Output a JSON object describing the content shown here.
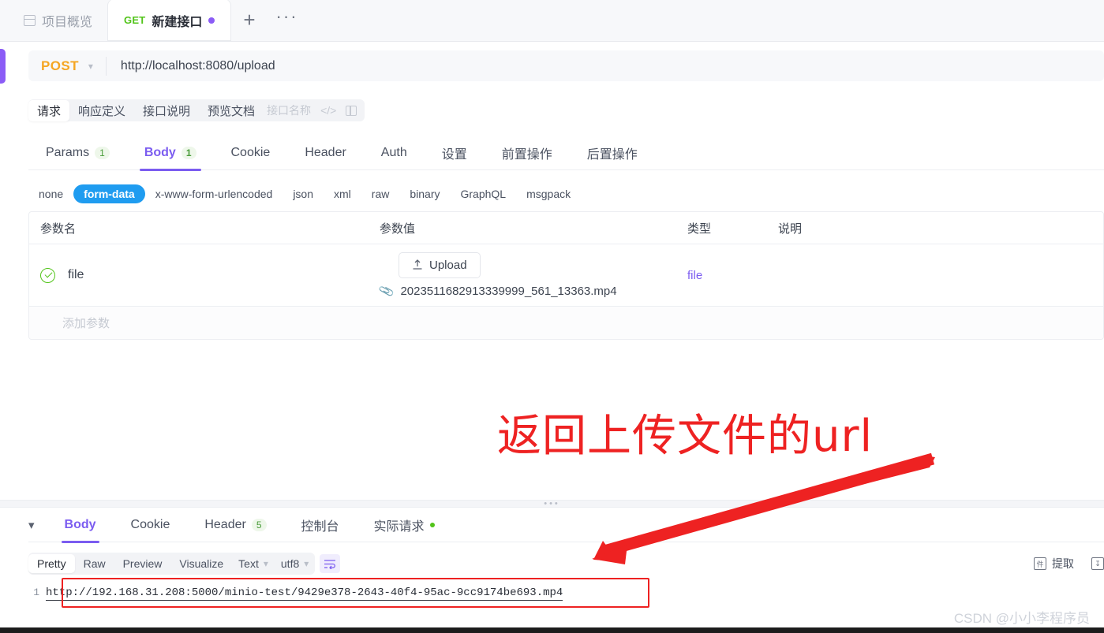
{
  "window": {
    "tabs": [
      {
        "icon": "window-icon",
        "label": "项目概览",
        "active": false
      },
      {
        "method": "GET",
        "label": "新建接口",
        "active": true,
        "dirty_dot": true
      }
    ],
    "new_tab_label": "+",
    "more_label": "···"
  },
  "request": {
    "method": "POST",
    "url": "http://localhost:8080/upload",
    "subtabs": [
      {
        "label": "请求",
        "active": true
      },
      {
        "label": "响应定义",
        "active": false
      },
      {
        "label": "接口说明",
        "active": false
      },
      {
        "label": "预览文档",
        "active": false
      }
    ],
    "name_placeholder": "接口名称",
    "code_icon": "</>",
    "main_tabs": [
      {
        "label": "Params",
        "count": "1",
        "active": false
      },
      {
        "label": "Body",
        "count": "1",
        "active": true
      },
      {
        "label": "Cookie",
        "count": "",
        "active": false
      },
      {
        "label": "Header",
        "count": "",
        "active": false
      },
      {
        "label": "Auth",
        "count": "",
        "active": false
      },
      {
        "label": "设置",
        "count": "",
        "active": false
      },
      {
        "label": "前置操作",
        "count": "",
        "active": false
      },
      {
        "label": "后置操作",
        "count": "",
        "active": false
      }
    ],
    "body_types": [
      {
        "label": "none",
        "active": false
      },
      {
        "label": "form-data",
        "active": true
      },
      {
        "label": "x-www-form-urlencoded",
        "active": false
      },
      {
        "label": "json",
        "active": false
      },
      {
        "label": "xml",
        "active": false
      },
      {
        "label": "raw",
        "active": false
      },
      {
        "label": "binary",
        "active": false
      },
      {
        "label": "GraphQL",
        "active": false
      },
      {
        "label": "msgpack",
        "active": false
      }
    ],
    "table": {
      "headers": {
        "name": "参数名",
        "value": "参数值",
        "type": "类型",
        "desc": "说明"
      },
      "row": {
        "enabled": true,
        "name": "file",
        "upload_label": "Upload",
        "filename": "2023511682913339999_561_13363.mp4",
        "type": "file",
        "desc": ""
      },
      "add_row_label": "添加参数"
    }
  },
  "annotation": {
    "text": "返回上传文件的url",
    "color": "#ee2222"
  },
  "response": {
    "collapse_icon": "chevron-down-icon",
    "tabs": [
      {
        "label": "Body",
        "count": "",
        "active": true,
        "dot": false
      },
      {
        "label": "Cookie",
        "count": "",
        "active": false,
        "dot": false
      },
      {
        "label": "Header",
        "count": "5",
        "active": false,
        "dot": false
      },
      {
        "label": "控制台",
        "count": "",
        "active": false,
        "dot": false
      },
      {
        "label": "实际请求",
        "count": "",
        "active": false,
        "dot": true
      }
    ],
    "format_tabs": [
      {
        "label": "Pretty",
        "active": true
      },
      {
        "label": "Raw",
        "active": false
      },
      {
        "label": "Preview",
        "active": false
      },
      {
        "label": "Visualize",
        "active": false
      }
    ],
    "type_select": "Text",
    "encoding_select": "utf8",
    "wrap_icon": "wrap-lines-icon",
    "extract_label": "提取",
    "download_icon": "download-icon",
    "line_number": "1",
    "body_text": "http://192.168.31.208:5000/minio-test/9429e378-2643-40f4-95ac-9cc9174be693.mp4"
  },
  "watermark": "CSDN @小小李程序员"
}
